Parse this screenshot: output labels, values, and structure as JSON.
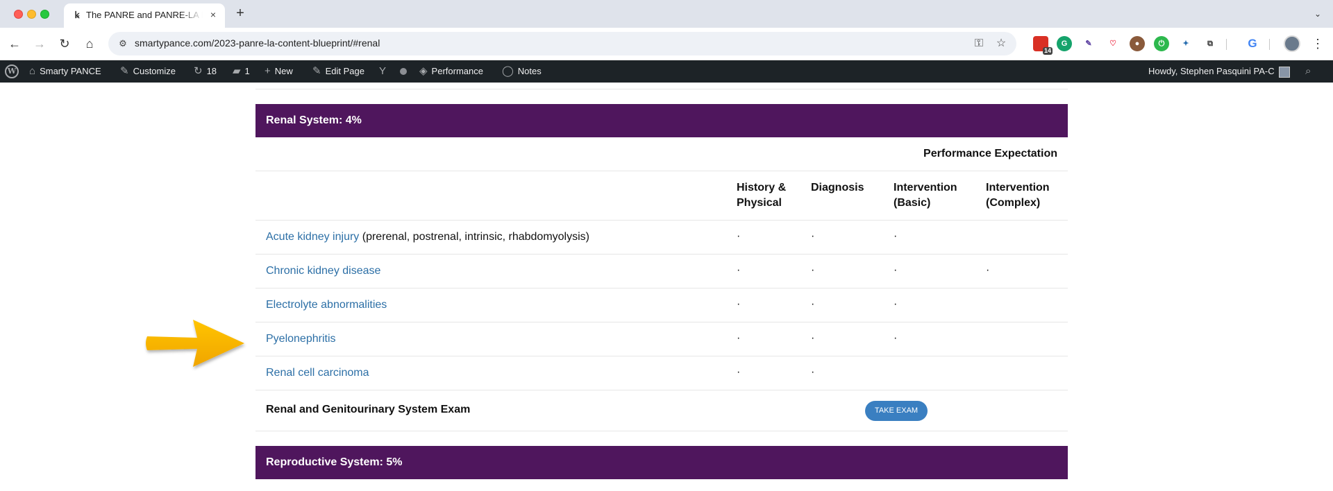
{
  "browser": {
    "tab_title": "The PANRE and PANRE-LA Interactive Content Blueprint",
    "tab_close": "×",
    "new_tab": "+",
    "url": "smartypance.com/2023-panre-la-content-blueprint/#renal",
    "extension_badge": "14"
  },
  "adminbar": {
    "site_name": "Smarty PANCE",
    "customize": "Customize",
    "updates_count": "18",
    "comments_count": "1",
    "new": "New",
    "edit_page": "Edit Page",
    "performance": "Performance",
    "notes": "Notes",
    "howdy": "Howdy, Stephen Pasquini PA-C"
  },
  "renal": {
    "title": "Renal System: 4%",
    "performance_expectation": "Performance Expectation",
    "columns": {
      "hp": "History & Physical",
      "diagnosis": "Diagnosis",
      "int_basic": "Intervention (Basic)",
      "int_complex": "Intervention (Complex)"
    },
    "rows": [
      {
        "name": "Acute kidney injury",
        "note": "(prerenal, postrenal, intrinsic, rhabdomyolysis)",
        "hp": "·",
        "diagnosis": "·",
        "int_basic": "·",
        "int_complex": ""
      },
      {
        "name": "Chronic kidney disease",
        "note": "",
        "hp": "·",
        "diagnosis": "·",
        "int_basic": "·",
        "int_complex": "·"
      },
      {
        "name": "Electrolyte abnormalities",
        "note": "",
        "hp": "·",
        "diagnosis": "·",
        "int_basic": "·",
        "int_complex": ""
      },
      {
        "name": "Pyelonephritis",
        "note": "",
        "hp": "·",
        "diagnosis": "·",
        "int_basic": "·",
        "int_complex": ""
      },
      {
        "name": "Renal cell carcinoma",
        "note": "",
        "hp": "·",
        "diagnosis": "·",
        "int_basic": "",
        "int_complex": ""
      }
    ],
    "exam_title": "Renal and Genitourinary System Exam",
    "exam_button": "TAKE EXAM"
  },
  "reproductive": {
    "title": "Reproductive System: 5%"
  },
  "colors": {
    "section_bar": "#4f165d",
    "link": "#2c6fa6",
    "exam_button": "#3a7fc1",
    "arrow": "#f5b400"
  }
}
